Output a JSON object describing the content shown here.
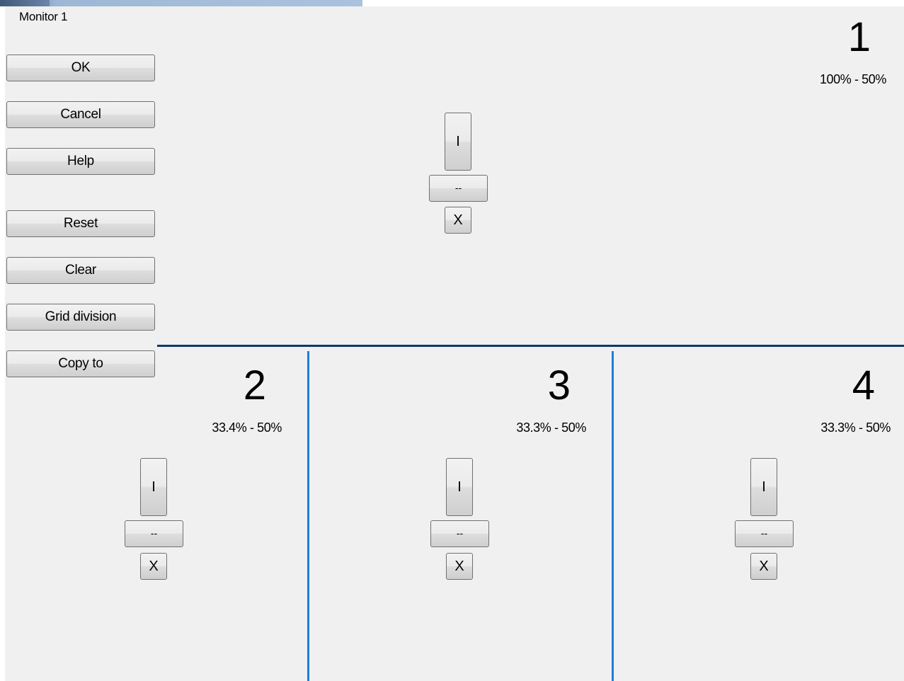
{
  "window": {
    "title": "Monitor 1"
  },
  "sidebar": {
    "buttons": [
      {
        "label": "OK"
      },
      {
        "label": "Cancel"
      },
      {
        "label": "Help"
      },
      {
        "label": "Reset"
      },
      {
        "label": "Clear"
      },
      {
        "label": "Grid division"
      },
      {
        "label": "Copy to"
      }
    ]
  },
  "zones": [
    {
      "number": "1",
      "percent": "100% - 50%",
      "controls": {
        "vertical": "I",
        "horizontal": "--",
        "close": "X"
      }
    },
    {
      "number": "2",
      "percent": "33.4% - 50%",
      "controls": {
        "vertical": "I",
        "horizontal": "--",
        "close": "X"
      }
    },
    {
      "number": "3",
      "percent": "33.3% - 50%",
      "controls": {
        "vertical": "I",
        "horizontal": "--",
        "close": "X"
      }
    },
    {
      "number": "4",
      "percent": "33.3% - 50%",
      "controls": {
        "vertical": "I",
        "horizontal": "--",
        "close": "X"
      }
    }
  ],
  "colors": {
    "background": "#f0f0f0",
    "horizontal_divider": "#0d3b66",
    "vertical_divider": "#1c7fd8"
  }
}
